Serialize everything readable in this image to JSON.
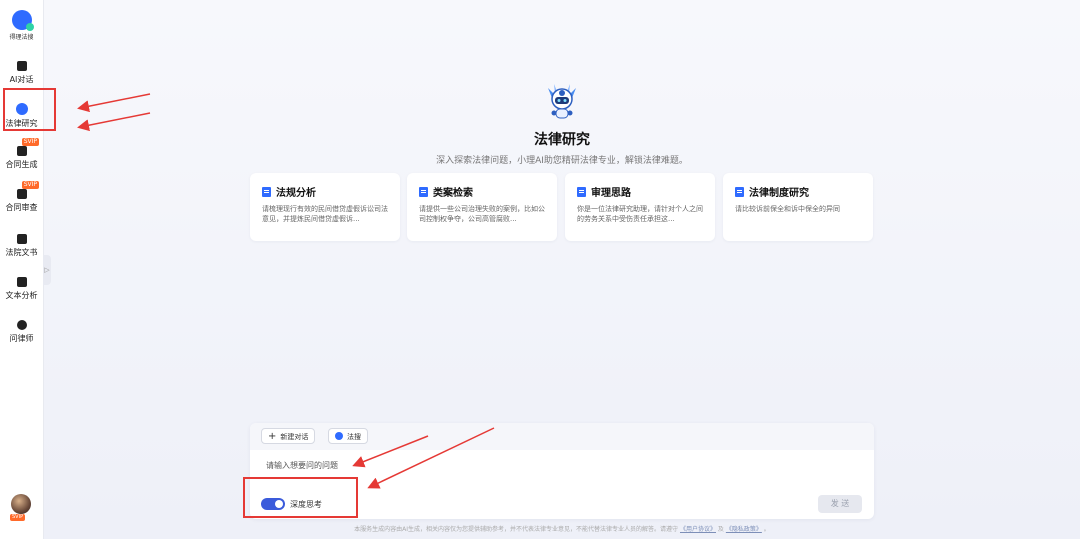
{
  "sidebar": {
    "logo_text": "得理法搜",
    "items": [
      {
        "label": "AI对话",
        "icon": "chat-icon"
      },
      {
        "label": "法律研究",
        "icon": "research-icon"
      },
      {
        "label": "合同生成",
        "icon": "contract-generate-icon",
        "badge": "SVIP"
      },
      {
        "label": "合同审查",
        "icon": "contract-review-icon",
        "badge": "SVIP"
      },
      {
        "label": "法院文书",
        "icon": "court-document-icon"
      },
      {
        "label": "文本分析",
        "icon": "text-analysis-icon"
      },
      {
        "label": "问律师",
        "icon": "lawyer-icon"
      }
    ],
    "collapse_glyph": "▷",
    "avatar_badge": "SVIP"
  },
  "main": {
    "title": "法律研究",
    "subtitle": "深入探索法律问题，小理AI助您精研法律专业，解锁法律难题。",
    "cards": [
      {
        "title": "法规分析",
        "desc": "请梳理现行有效的民间借贷虚假诉讼司法意见，并提炼民间借贷虚假诉..."
      },
      {
        "title": "类案检索",
        "desc": "请提供一些公司治理失败的案例，比如公司控制权争夺，公司高管腐败..."
      },
      {
        "title": "审理思路",
        "desc": "你是一位法律研究助理，请针对个人之间的劳务关系中受伤责任承担这..."
      },
      {
        "title": "法律制度研究",
        "desc": "请比较诉前保全和诉中保全的异同"
      }
    ]
  },
  "chat": {
    "new_chat_label": "新建对话",
    "search_label": "法搜",
    "input_placeholder": "请输入想要问的问题",
    "deep_think_label": "深度思考",
    "send_label": "发 送"
  },
  "footer": {
    "disclaimer_prefix": "本服务生成内容由AI生成，相关内容仅为您提供辅助参考，并不代表法律专业意见，不能代替法律专业人员的解答。请遵守",
    "user_agreement": "《用户协议》",
    "and": "及",
    "privacy_policy": "《隐私政策》",
    "suffix": "。"
  },
  "colors": {
    "accent": "#2f6bff",
    "toggle": "#3b5bdb",
    "annotation": "#e53935",
    "vip_badge": "#ff6a2a"
  }
}
